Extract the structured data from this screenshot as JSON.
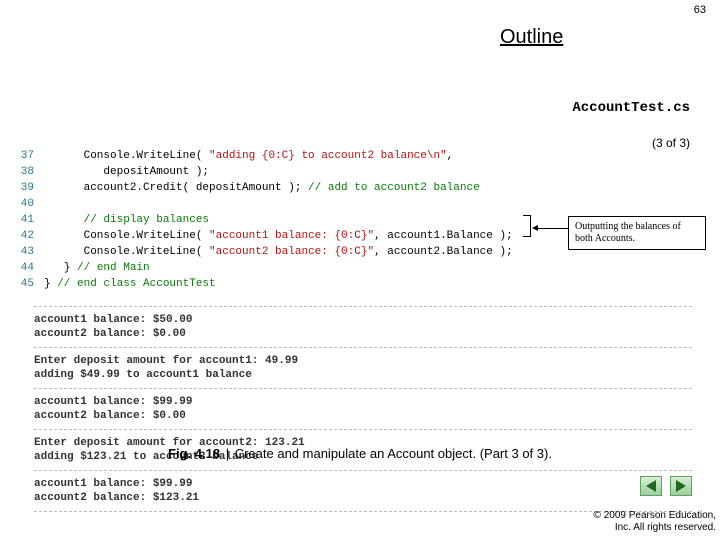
{
  "page_number": "63",
  "outline": "Outline",
  "file_name": "AccountTest.cs",
  "part": "(3 of 3)",
  "code": {
    "lines": [
      {
        "n": "37",
        "spans": [
          {
            "cls": "kw-black",
            "t": "      Console.WriteLine( "
          },
          {
            "cls": "kw-str",
            "t": "\"adding {0:C} to account2 balance\\n\""
          },
          {
            "cls": "kw-black",
            "t": ","
          }
        ]
      },
      {
        "n": "38",
        "spans": [
          {
            "cls": "kw-black",
            "t": "         depositAmount );"
          }
        ]
      },
      {
        "n": "39",
        "spans": [
          {
            "cls": "kw-black",
            "t": "      account2.Credit( depositAmount ); "
          },
          {
            "cls": "kw-green",
            "t": "// add to account2 balance"
          }
        ]
      },
      {
        "n": "40",
        "spans": [
          {
            "cls": "kw-black",
            "t": ""
          }
        ]
      },
      {
        "n": "41",
        "spans": [
          {
            "cls": "kw-green",
            "t": "      // display balances"
          }
        ]
      },
      {
        "n": "42",
        "spans": [
          {
            "cls": "kw-black",
            "t": "      Console.WriteLine( "
          },
          {
            "cls": "kw-str",
            "t": "\"account1 balance: {0:C}\""
          },
          {
            "cls": "kw-black",
            "t": ", account1.Balance );"
          }
        ]
      },
      {
        "n": "43",
        "spans": [
          {
            "cls": "kw-black",
            "t": "      Console.WriteLine( "
          },
          {
            "cls": "kw-str",
            "t": "\"account2 balance: {0:C}\""
          },
          {
            "cls": "kw-black",
            "t": ", account2.Balance );"
          }
        ]
      },
      {
        "n": "44",
        "spans": [
          {
            "cls": "kw-black",
            "t": "   } "
          },
          {
            "cls": "kw-green",
            "t": "// end Main"
          }
        ]
      },
      {
        "n": "45",
        "spans": [
          {
            "cls": "kw-black",
            "t": "} "
          },
          {
            "cls": "kw-green",
            "t": "// end class AccountTest"
          }
        ]
      }
    ]
  },
  "callout_text": "Outputting the balances of both Accounts.",
  "output_blocks": [
    [
      "account1 balance: $50.00",
      "account2 balance: $0.00"
    ],
    [
      "Enter deposit amount for account1: 49.99",
      "adding $49.99 to account1 balance"
    ],
    [
      "account1 balance: $99.99",
      "account2 balance: $0.00"
    ],
    [
      "Enter deposit amount for account2: 123.21",
      "adding $123.21 to account2 balance"
    ],
    [
      "account1 balance: $99.99",
      "account2 balance: $123.21"
    ]
  ],
  "figure": {
    "num": "Fig. 4.18",
    "sep": "|",
    "text": "Create and manipulate an Account object. (Part 3 of 3)."
  },
  "copyright": {
    "l1": "© 2009 Pearson Education,",
    "l2": "Inc. All rights reserved."
  }
}
